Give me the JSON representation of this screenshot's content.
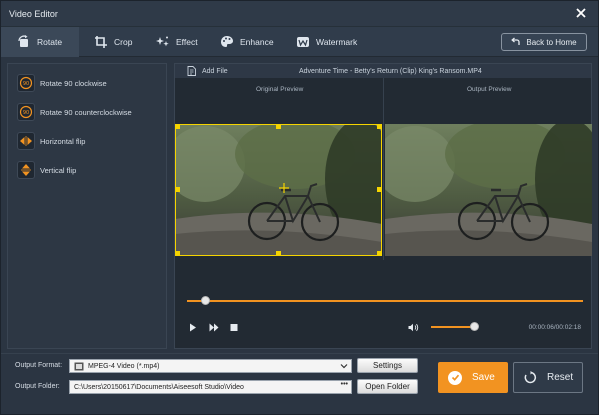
{
  "window": {
    "title": "Video Editor"
  },
  "tabs": [
    {
      "label": "Rotate",
      "icon": "rotate-icon",
      "active": true
    },
    {
      "label": "Crop",
      "icon": "crop-icon",
      "active": false
    },
    {
      "label": "Effect",
      "icon": "effect-icon",
      "active": false
    },
    {
      "label": "Enhance",
      "icon": "enhance-icon",
      "active": false
    },
    {
      "label": "Watermark",
      "icon": "watermark-icon",
      "active": false
    }
  ],
  "back_button": {
    "label": "Back to Home",
    "icon": "back-arrow-icon"
  },
  "rotate_options": [
    {
      "label": "Rotate 90 clockwise",
      "icon": "rotate-cw-icon"
    },
    {
      "label": "Rotate 90 counterclockwise",
      "icon": "rotate-ccw-icon"
    },
    {
      "label": "Horizontal flip",
      "icon": "flip-horizontal-icon"
    },
    {
      "label": "Vertical flip",
      "icon": "flip-vertical-icon"
    }
  ],
  "preview": {
    "add_file_label": "Add File",
    "file_name": "Adventure Time - Betty's Return (Clip) King's Ransom.MP4",
    "original_label": "Original Preview",
    "output_label": "Output Preview"
  },
  "player": {
    "current_time": "00:00:06",
    "total_time": "00:02:18",
    "time_display": "00:00:06/00:02:18",
    "progress_fraction": 0.04,
    "volume_fraction": 1.0
  },
  "output": {
    "format_label": "Output Format:",
    "format_value": "MPEG-4 Video (*.mp4)",
    "settings_label": "Settings",
    "folder_label": "Output Folder:",
    "folder_value": "C:\\Users\\20150617\\Documents\\Aiseesoft Studio\\Video",
    "open_folder_label": "Open Folder",
    "browse_label": "•••"
  },
  "actions": {
    "save_label": "Save",
    "reset_label": "Reset"
  },
  "colors": {
    "accent": "#f29321",
    "crop": "#f5d400",
    "background": "#2b3542"
  }
}
